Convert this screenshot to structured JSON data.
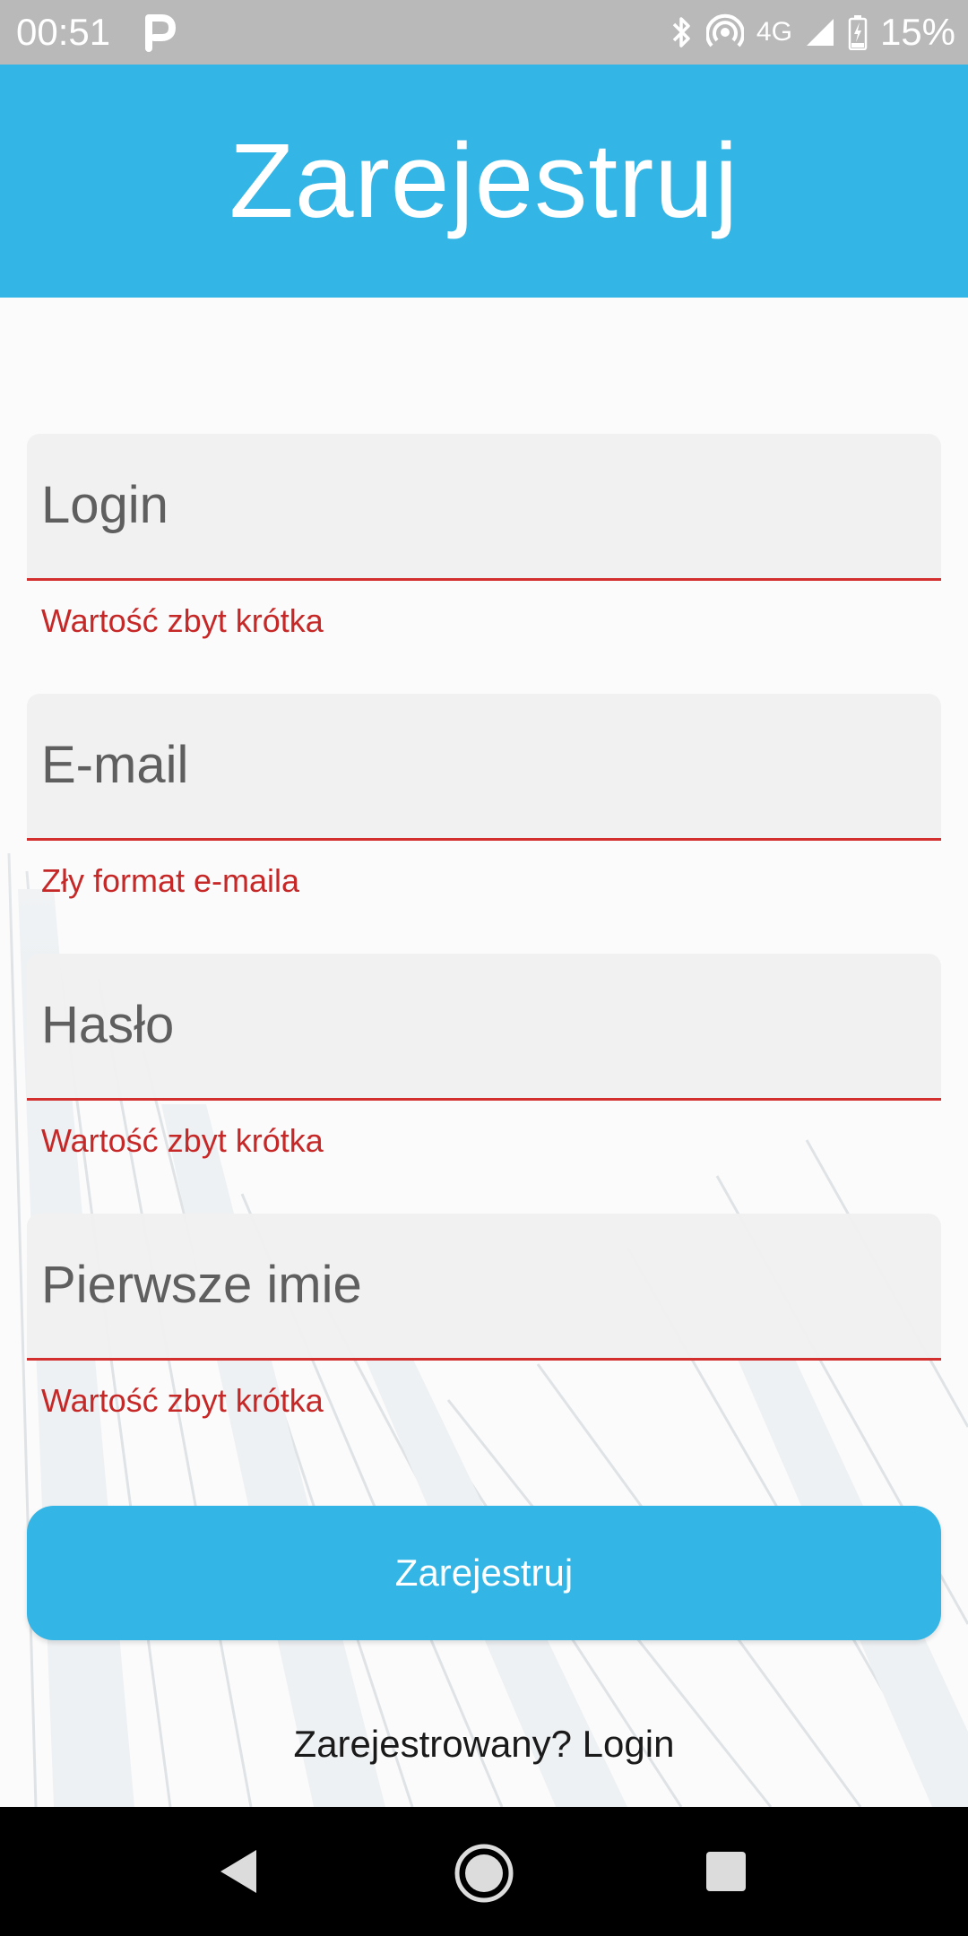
{
  "status_bar": {
    "time": "00:51",
    "network": "4G",
    "battery": "15%",
    "app_icon": "parking-p-icon",
    "icons": [
      "bluetooth-icon",
      "hotspot-icon",
      "signal-icon",
      "battery-charging-icon"
    ]
  },
  "header": {
    "title": "Zarejestruj",
    "color": "#33b5e5"
  },
  "form": {
    "login": {
      "placeholder": "Login",
      "error": "Wartość zbyt krótka"
    },
    "email": {
      "placeholder": "E-mail",
      "error": "Zły format e-maila"
    },
    "password": {
      "placeholder": "Hasło",
      "error": "Wartość zbyt krótka"
    },
    "first_name": {
      "placeholder": "Pierwsze imie",
      "error": "Wartość zbyt krótka"
    },
    "error_color": "#c62828",
    "submit_label": "Zarejestruj",
    "login_link": "Zarejestrowany? Login"
  },
  "nav_bar": {
    "icons": [
      "back-icon",
      "home-icon",
      "recent-apps-icon"
    ]
  }
}
